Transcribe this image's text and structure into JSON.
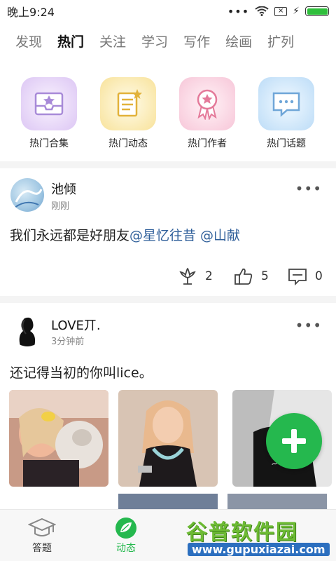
{
  "status_bar": {
    "time": "晚上9:24",
    "dots": "•••"
  },
  "tabs": [
    {
      "label": "发现"
    },
    {
      "label": "热门"
    },
    {
      "label": "关注"
    },
    {
      "label": "学习"
    },
    {
      "label": "写作"
    },
    {
      "label": "绘画"
    },
    {
      "label": "扩列"
    }
  ],
  "categories": [
    {
      "label": "热门合集",
      "icon": "envelope-star-icon"
    },
    {
      "label": "热门动态",
      "icon": "notepad-star-icon"
    },
    {
      "label": "热门作者",
      "icon": "award-ribbon-icon"
    },
    {
      "label": "热门话题",
      "icon": "chat-bubble-icon"
    }
  ],
  "posts": [
    {
      "author": "池倾",
      "time": "刚刚",
      "text": "我们永远都是好朋友",
      "mentions": "@星忆往昔 @山献",
      "flowers": "2",
      "likes": "5",
      "comments": "0"
    },
    {
      "author": "LOVE丌.",
      "time": "3分钟前",
      "text": "还记得当初的你叫lice。"
    }
  ],
  "bottom_nav": [
    {
      "label": "答题",
      "icon": "graduation-cap-icon"
    },
    {
      "label": "动态",
      "icon": "leaf-bubble-icon"
    }
  ],
  "watermark": {
    "big": "谷普软件园",
    "small": "www.gupuxiazai.com"
  },
  "colors": {
    "accent": "#25b84e",
    "mention": "#2f5f9a"
  }
}
